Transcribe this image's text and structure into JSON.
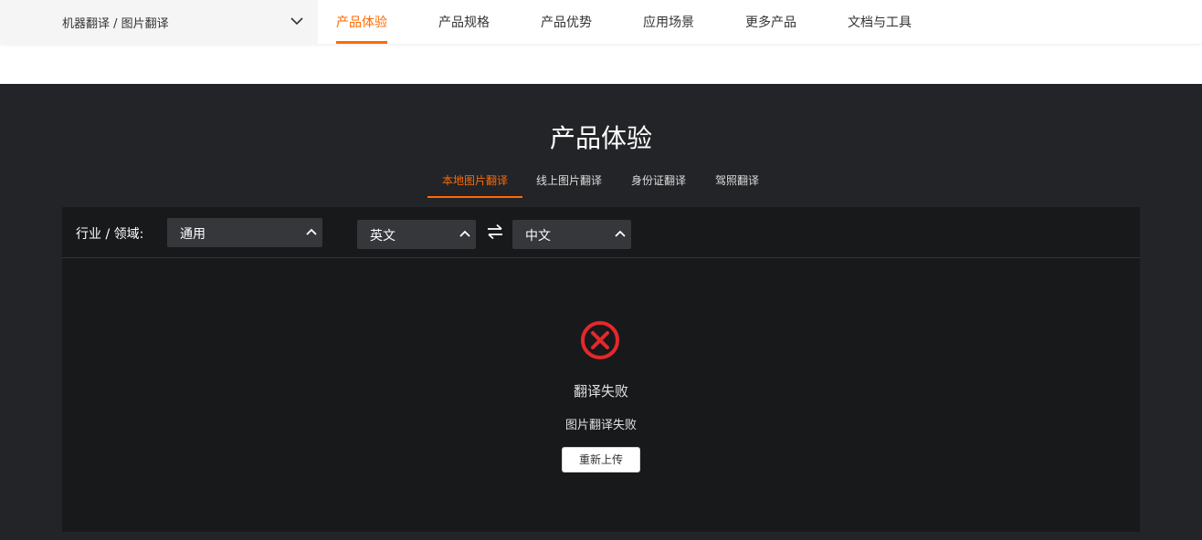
{
  "header": {
    "breadcrumb": "机器翻译 / 图片翻译",
    "breadcrumb_icon": "chevron-down-icon",
    "tabs": [
      {
        "label": "产品体验",
        "active": true
      },
      {
        "label": "产品规格",
        "active": false
      },
      {
        "label": "产品优势",
        "active": false
      },
      {
        "label": "应用场景",
        "active": false
      },
      {
        "label": "更多产品",
        "active": false
      },
      {
        "label": "文档与工具",
        "active": false
      }
    ]
  },
  "section": {
    "title": "产品体验",
    "sub_tabs": [
      {
        "label": "本地图片翻译",
        "active": true
      },
      {
        "label": "线上图片翻译",
        "active": false
      },
      {
        "label": "身份证翻译",
        "active": false
      },
      {
        "label": "驾照翻译",
        "active": false
      }
    ]
  },
  "toolbar": {
    "domain_label": "行业 / 领域:",
    "domain_value": "通用",
    "source_lang": "英文",
    "target_lang": "中文",
    "swap_icon": "swap-arrows-icon"
  },
  "result": {
    "status_icon": "error-circle-icon",
    "title": "翻译失败",
    "description": "图片翻译失败",
    "retry_label": "重新上传"
  },
  "colors": {
    "accent": "#ff6a00",
    "error": "#e4282b",
    "dark_bg": "#232427",
    "panel_bg": "#18191b"
  }
}
